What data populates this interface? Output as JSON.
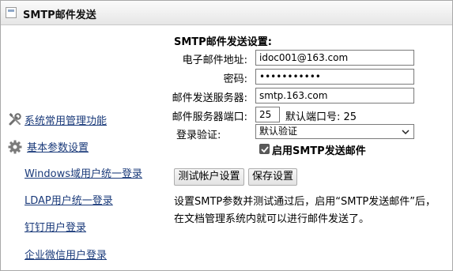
{
  "window": {
    "title": "SMTP邮件发送"
  },
  "sidebar": {
    "items": [
      {
        "label": "系统常用管理功能",
        "icon": "wrench-screwdriver-icon"
      },
      {
        "label": "基本参数设置",
        "icon": "gear-icon"
      },
      {
        "label": "Windows域用户统一登录"
      },
      {
        "label": "LDAP用户统一登录"
      },
      {
        "label": "钉钉用户登录"
      },
      {
        "label": "企业微信用户登录"
      }
    ]
  },
  "form": {
    "section_title": "SMTP邮件发送设置:",
    "email_label": "电子邮件地址:",
    "email_value": "idoc001@163.com",
    "password_label": "密码:",
    "password_value": "•••••••••••",
    "server_label": "邮件发送服务器:",
    "server_value": "smtp.163.com",
    "port_label": "邮件服务器端口:",
    "port_value": "25",
    "default_port_text": "默认端口号: 25",
    "auth_label": "登录验证:",
    "auth_selected": "默认验证",
    "enable_smtp_label": "启用SMTP发送邮件",
    "enable_smtp_checked": true
  },
  "buttons": {
    "test_account": "测试帐户设置",
    "save_settings": "保存设置"
  },
  "note": {
    "line1": "设置SMTP参数并测试通过后，启用“SMTP发送邮件”后，",
    "line2": "在文档管理系统内就可以进行邮件发送了。"
  }
}
